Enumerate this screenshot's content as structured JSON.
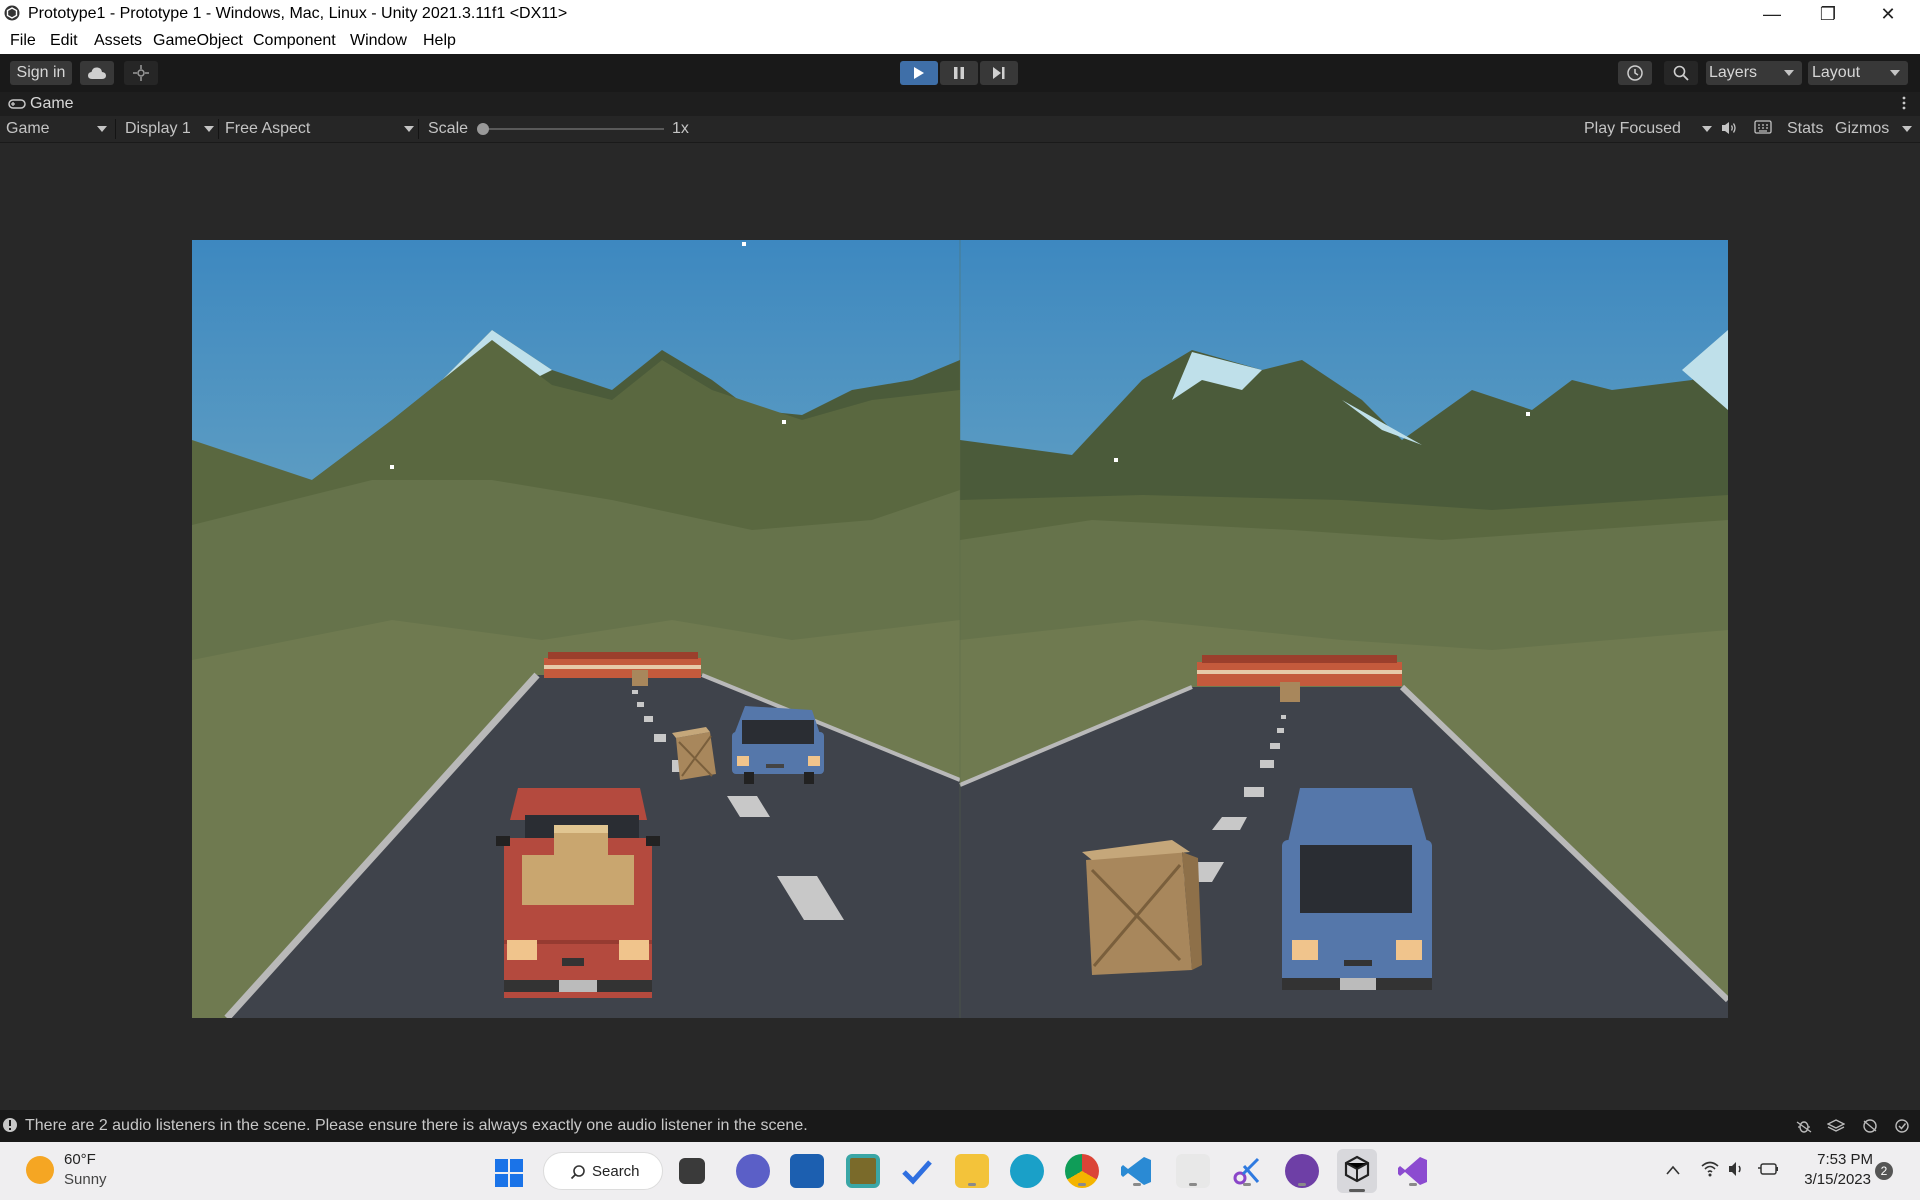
{
  "window": {
    "title": "Prototype1 - Prototype 1 - Windows, Mac, Linux - Unity 2021.3.11f1 <DX11>",
    "controls": [
      "minimize",
      "restore",
      "close"
    ]
  },
  "menu": [
    "File",
    "Edit",
    "Assets",
    "GameObject",
    "Component",
    "Window",
    "Help"
  ],
  "toolbar": {
    "sign_in": "Sign in",
    "play_state": "playing",
    "layers": "Layers",
    "layout": "Layout"
  },
  "game_tab": {
    "label": "Game",
    "view_select": "Game",
    "display_select": "Display 1",
    "aspect_select": "Free Aspect",
    "scale_label": "Scale",
    "scale_value": "1x",
    "play_mode_select": "Play Focused",
    "stats": "Stats",
    "gizmos": "Gizmos"
  },
  "status": {
    "message": "There are 2 audio listeners in the scene. Please ensure there is always exactly one audio listener in the scene."
  },
  "taskbar": {
    "weather_temp": "60°F",
    "weather_desc": "Sunny",
    "search_label": "Search",
    "time": "7:53 PM",
    "date": "3/15/2023",
    "notification_count": "2"
  },
  "colors": {
    "sky": "#4a8fc0",
    "hills": "#5d6b42",
    "road": "#3f434b",
    "red_truck": "#b44a3e",
    "blue_van": "#5577aa",
    "crate": "#a8875c",
    "play_active": "#3f6fa8"
  }
}
